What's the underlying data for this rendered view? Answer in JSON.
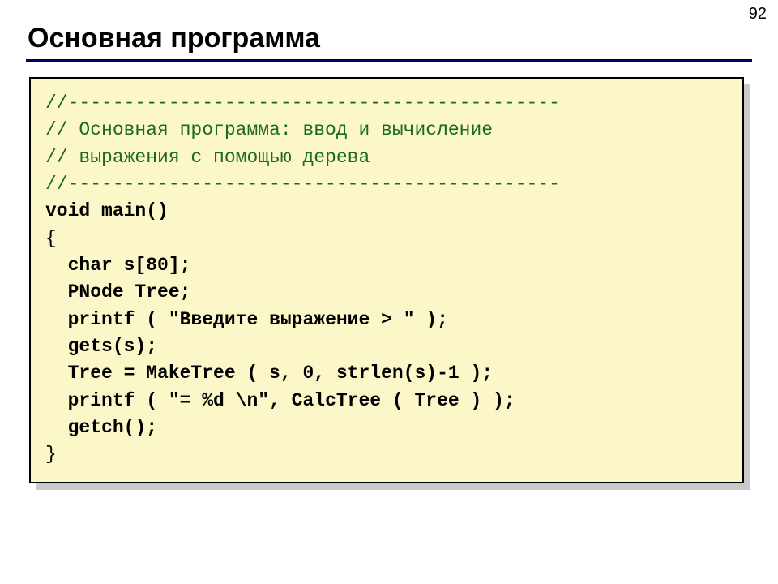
{
  "page_number": "92",
  "title": "Основная программа",
  "code": {
    "c1": "//--------------------------------------------",
    "c2": "// Основная программа: ввод и вычисление",
    "c3": "// выражения с помощью дерева",
    "c4": "//--------------------------------------------",
    "l1a": "void",
    "l1b": " main()",
    "l2": "{",
    "l3a": "  char",
    "l3b": " s[80];",
    "l4": "  PNode Tree;",
    "l5a": "  printf",
    "l5b": " ( ",
    "l5c": "\"Введите выражение > \"",
    "l5d": " );",
    "l6": "  gets(s);",
    "l7": "  Tree = MakeTree ( s, 0, strlen(s)-1 );",
    "l8a": "  printf",
    "l8b": " ( ",
    "l8c": "\"= %d \\n\"",
    "l8d": ", CalcTree ( Tree ) );",
    "l9": "  getch();",
    "l10": "}"
  }
}
